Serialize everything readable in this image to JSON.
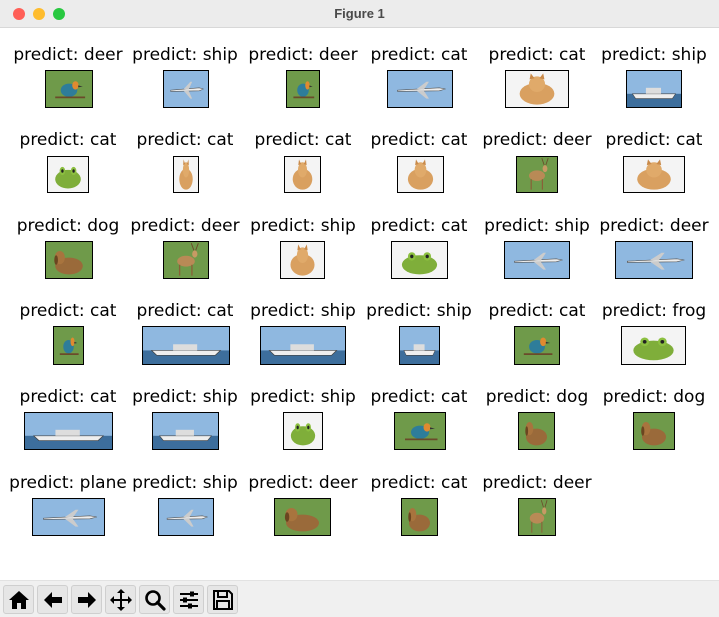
{
  "window": {
    "title": "Figure 1",
    "traffic_colors": {
      "close": "#ff5f57",
      "minimize": "#febc2e",
      "maximize": "#28c840"
    }
  },
  "figure": {
    "rows": [
      [
        {
          "label": "predict: deer",
          "image": "bird-on-branch"
        },
        {
          "label": "predict: ship",
          "image": "airplane-sky"
        },
        {
          "label": "predict: deer",
          "image": "bird-small"
        },
        {
          "label": "predict: cat",
          "image": "airplane-airliner"
        },
        {
          "label": "predict: cat",
          "image": "kitten-lying"
        },
        {
          "label": "predict: ship",
          "image": "cargo-ship"
        }
      ],
      [
        {
          "label": "predict: cat",
          "image": "frog-portrait"
        },
        {
          "label": "predict: cat",
          "image": "cat-dark"
        },
        {
          "label": "predict: cat",
          "image": "kitten-grey"
        },
        {
          "label": "predict: cat",
          "image": "cat-face"
        },
        {
          "label": "predict: deer",
          "image": "deer-grass"
        },
        {
          "label": "predict: cat",
          "image": "kitten-red-blanket"
        }
      ],
      [
        {
          "label": "predict: dog",
          "image": "dog-weimaraner"
        },
        {
          "label": "predict: deer",
          "image": "deer-antlers"
        },
        {
          "label": "predict: ship",
          "image": "kitten-tabby"
        },
        {
          "label": "predict: cat",
          "image": "frog-green"
        },
        {
          "label": "predict: ship",
          "image": "small-plane"
        },
        {
          "label": "predict: deer",
          "image": "airliner-ground"
        }
      ],
      [
        {
          "label": "predict: cat",
          "image": "kingfisher"
        },
        {
          "label": "predict: cat",
          "image": "warship"
        },
        {
          "label": "predict: ship",
          "image": "speedboat"
        },
        {
          "label": "predict: ship",
          "image": "longtail-boat"
        },
        {
          "label": "predict: cat",
          "image": "bird-colorful"
        },
        {
          "label": "predict: frog",
          "image": "frog-brown"
        }
      ],
      [
        {
          "label": "predict: cat",
          "image": "yacht"
        },
        {
          "label": "predict: ship",
          "image": "tall-ship"
        },
        {
          "label": "predict: ship",
          "image": "frog-cartoon"
        },
        {
          "label": "predict: cat",
          "image": "robin-bird"
        },
        {
          "label": "predict: dog",
          "image": "german-shepherd"
        },
        {
          "label": "predict: dog",
          "image": "beagle-face"
        }
      ],
      [
        {
          "label": "predict: plane",
          "image": "jet-plane"
        },
        {
          "label": "predict: ship",
          "image": "fighter-jet"
        },
        {
          "label": "predict: deer",
          "image": "dog-lying"
        },
        {
          "label": "predict: cat",
          "image": "beagle-standing"
        },
        {
          "label": "predict: deer",
          "image": "deer-standing"
        }
      ]
    ]
  },
  "toolbar": {
    "buttons": [
      "home-icon",
      "back-arrow-icon",
      "forward-arrow-icon",
      "pan-icon",
      "zoom-icon",
      "configure-subplots-icon",
      "save-icon"
    ]
  }
}
